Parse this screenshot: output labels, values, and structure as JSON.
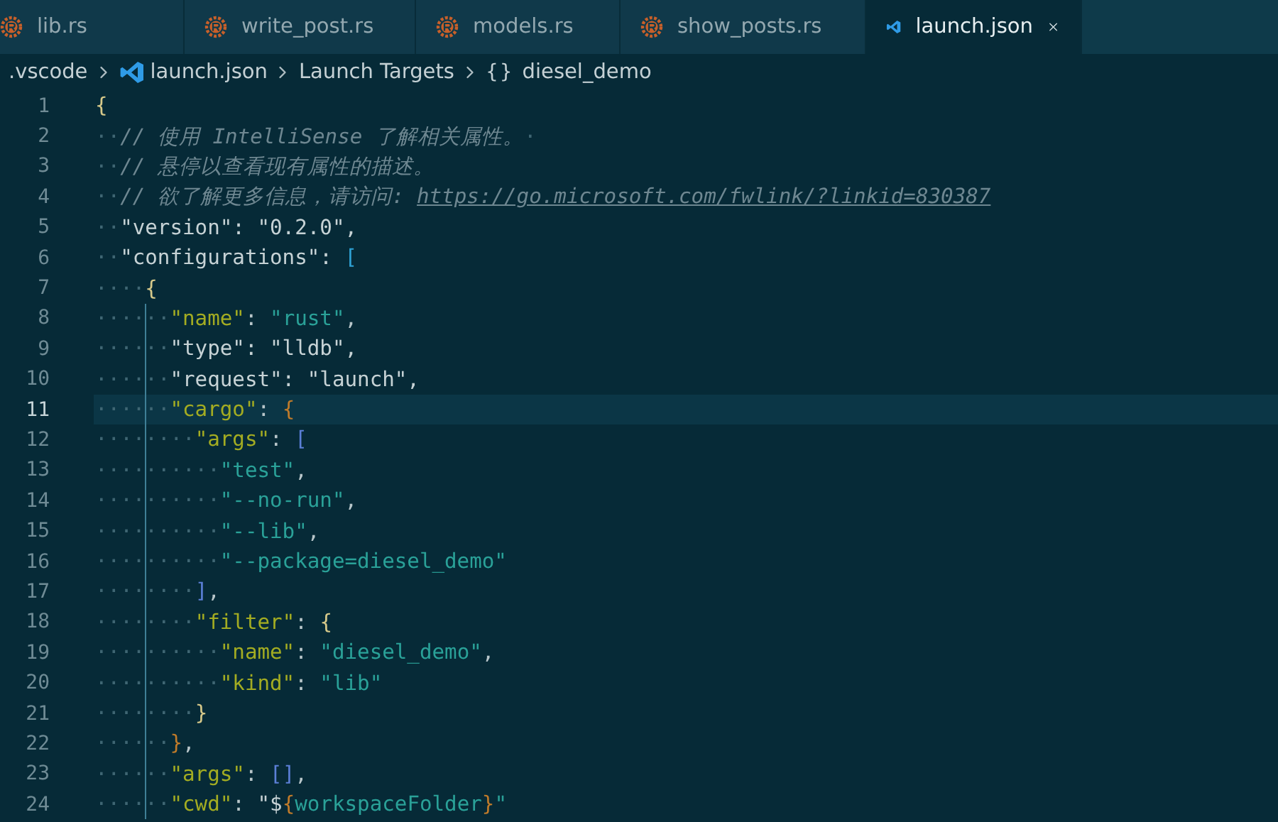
{
  "tabs": [
    {
      "label": "lib.rs",
      "kind": "rust",
      "selected": false
    },
    {
      "label": "write_post.rs",
      "kind": "rust",
      "selected": false
    },
    {
      "label": "models.rs",
      "kind": "rust",
      "selected": false
    },
    {
      "label": "show_posts.rs",
      "kind": "rust",
      "selected": false
    },
    {
      "label": "launch.json",
      "kind": "vscode",
      "selected": true
    }
  ],
  "breadcrumb": [
    {
      "label": ".vscode",
      "kind": "folder"
    },
    {
      "label": "launch.json",
      "kind": "file"
    },
    {
      "label": "Launch Targets",
      "kind": "section"
    },
    {
      "label": "diesel_demo",
      "kind": "symbol",
      "symbol": "{}"
    }
  ],
  "lines": [
    {
      "number": "1",
      "guide": false,
      "highlighted": false,
      "tokens": [
        {
          "kind": "bracket",
          "text": "{",
          "color": "#d6c98a"
        }
      ]
    },
    {
      "number": "2",
      "indent": "··",
      "trail": "·",
      "guide": false,
      "highlighted": false,
      "tokens": [
        {
          "kind": "comment",
          "text": "// 使用 IntelliSense 了解相关属性。"
        }
      ]
    },
    {
      "number": "3",
      "indent": "··",
      "guide": false,
      "highlighted": false,
      "tokens": [
        {
          "kind": "comment",
          "text": "// 悬停以查看现有属性的描述。"
        }
      ]
    },
    {
      "number": "4",
      "indent": "··",
      "guide": false,
      "highlighted": false,
      "tokens": [
        {
          "kind": "comment",
          "text": "// 欲了解更多信息，请访问: "
        },
        {
          "kind": "link",
          "text": "https://go.microsoft.com/fwlink/?linkid=830387"
        }
      ]
    },
    {
      "number": "5",
      "indent": "··",
      "guide": false,
      "highlighted": false,
      "tokens": [
        {
          "kind": "plain",
          "text": "\"version\": \"0.2.0\","
        }
      ]
    },
    {
      "number": "6",
      "indent": "··",
      "guide": false,
      "highlighted": false,
      "tokens": [
        {
          "kind": "plain",
          "text": "\"configurations\": "
        },
        {
          "kind": "bracket",
          "text": "[",
          "color": "#2fa3d6"
        }
      ]
    },
    {
      "number": "7",
      "indent": "····",
      "guide": false,
      "highlighted": false,
      "tokens": [
        {
          "kind": "bracket",
          "text": "{",
          "color": "#d6c98a"
        }
      ]
    },
    {
      "number": "8",
      "indent": "······",
      "guide": true,
      "highlighted": false,
      "tokens": [
        {
          "kind": "key",
          "text": "\"name\""
        },
        {
          "kind": "punct",
          "text": ": "
        },
        {
          "kind": "string",
          "text": "\"rust\""
        },
        {
          "kind": "punct",
          "text": ","
        }
      ]
    },
    {
      "number": "9",
      "indent": "······",
      "guide": true,
      "highlighted": false,
      "tokens": [
        {
          "kind": "plain",
          "text": "\"type\": \"lldb\","
        }
      ]
    },
    {
      "number": "10",
      "indent": "······",
      "guide": true,
      "highlighted": false,
      "tokens": [
        {
          "kind": "plain",
          "text": "\"request\": \"launch\","
        }
      ]
    },
    {
      "number": "11",
      "indent": "······",
      "guide": true,
      "highlighted": true,
      "tokens": [
        {
          "kind": "key",
          "text": "\"cargo\""
        },
        {
          "kind": "punct",
          "text": ": "
        },
        {
          "kind": "bracket",
          "text": "{",
          "color": "#c07b2a"
        }
      ]
    },
    {
      "number": "12",
      "indent": "········",
      "guide": true,
      "highlighted": false,
      "tokens": [
        {
          "kind": "key",
          "text": "\"args\""
        },
        {
          "kind": "punct",
          "text": ": "
        },
        {
          "kind": "bracket",
          "text": "[",
          "color": "#5b7fd6"
        }
      ]
    },
    {
      "number": "13",
      "indent": "··········",
      "guide": true,
      "highlighted": false,
      "tokens": [
        {
          "kind": "string",
          "text": "\"test\""
        },
        {
          "kind": "punct",
          "text": ","
        }
      ]
    },
    {
      "number": "14",
      "indent": "··········",
      "guide": true,
      "highlighted": false,
      "tokens": [
        {
          "kind": "string",
          "text": "\"--no-run\""
        },
        {
          "kind": "punct",
          "text": ","
        }
      ]
    },
    {
      "number": "15",
      "indent": "··········",
      "guide": true,
      "highlighted": false,
      "tokens": [
        {
          "kind": "string",
          "text": "\"--lib\""
        },
        {
          "kind": "punct",
          "text": ","
        }
      ]
    },
    {
      "number": "16",
      "indent": "··········",
      "guide": true,
      "highlighted": false,
      "tokens": [
        {
          "kind": "string",
          "text": "\"--package=diesel_demo\""
        }
      ]
    },
    {
      "number": "17",
      "indent": "········",
      "guide": true,
      "highlighted": false,
      "tokens": [
        {
          "kind": "bracket",
          "text": "]",
          "color": "#5b7fd6"
        },
        {
          "kind": "punct",
          "text": ","
        }
      ]
    },
    {
      "number": "18",
      "indent": "········",
      "guide": true,
      "highlighted": false,
      "tokens": [
        {
          "kind": "key",
          "text": "\"filter\""
        },
        {
          "kind": "punct",
          "text": ": "
        },
        {
          "kind": "bracket",
          "text": "{",
          "color": "#d6c98a"
        }
      ]
    },
    {
      "number": "19",
      "indent": "··········",
      "guide": true,
      "highlighted": false,
      "tokens": [
        {
          "kind": "key",
          "text": "\"name\""
        },
        {
          "kind": "punct",
          "text": ": "
        },
        {
          "kind": "string",
          "text": "\"diesel_demo\""
        },
        {
          "kind": "punct",
          "text": ","
        }
      ]
    },
    {
      "number": "20",
      "indent": "··········",
      "guide": true,
      "highlighted": false,
      "tokens": [
        {
          "kind": "key",
          "text": "\"kind\""
        },
        {
          "kind": "punct",
          "text": ": "
        },
        {
          "kind": "string",
          "text": "\"lib\""
        }
      ]
    },
    {
      "number": "21",
      "indent": "········",
      "guide": true,
      "highlighted": false,
      "tokens": [
        {
          "kind": "bracket",
          "text": "}",
          "color": "#d6c98a"
        }
      ]
    },
    {
      "number": "22",
      "indent": "······",
      "guide": true,
      "highlighted": false,
      "tokens": [
        {
          "kind": "bracket",
          "text": "}",
          "color": "#c07b2a"
        },
        {
          "kind": "punct",
          "text": ","
        }
      ]
    },
    {
      "number": "23",
      "indent": "······",
      "guide": true,
      "highlighted": false,
      "tokens": [
        {
          "kind": "key",
          "text": "\"args\""
        },
        {
          "kind": "punct",
          "text": ": "
        },
        {
          "kind": "bracket",
          "text": "[]",
          "color": "#5b7fd6"
        },
        {
          "kind": "punct",
          "text": ","
        }
      ]
    },
    {
      "number": "24",
      "indent": "······",
      "guide": true,
      "highlighted": false,
      "tokens": [
        {
          "kind": "key",
          "text": "\"cwd\""
        },
        {
          "kind": "punct",
          "text": ": "
        },
        {
          "kind": "plain",
          "text": "\"$"
        },
        {
          "kind": "bracket",
          "text": "{",
          "color": "#c07b2a"
        },
        {
          "kind": "string",
          "text": "workspaceFolder"
        },
        {
          "kind": "bracket",
          "text": "}",
          "color": "#c07b2a"
        },
        {
          "kind": "string",
          "text": "\""
        }
      ]
    }
  ]
}
